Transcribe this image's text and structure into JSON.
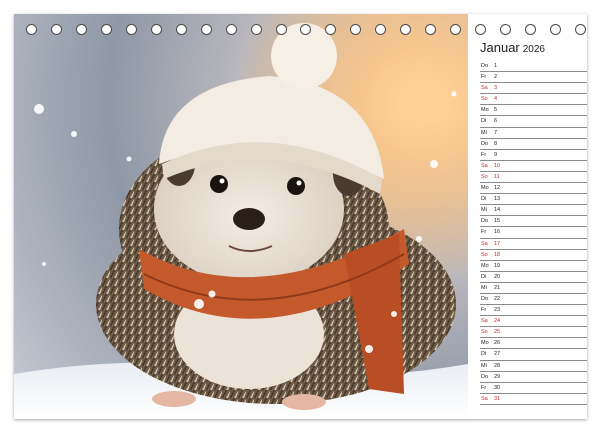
{
  "calendar": {
    "month": "Januar",
    "year": "2026",
    "days": [
      {
        "wd": "Do",
        "num": "1",
        "weekend": false
      },
      {
        "wd": "Fr",
        "num": "2",
        "weekend": false
      },
      {
        "wd": "Sa",
        "num": "3",
        "weekend": true
      },
      {
        "wd": "So",
        "num": "4",
        "weekend": true
      },
      {
        "wd": "Mo",
        "num": "5",
        "weekend": false
      },
      {
        "wd": "Di",
        "num": "6",
        "weekend": false
      },
      {
        "wd": "Mi",
        "num": "7",
        "weekend": false
      },
      {
        "wd": "Do",
        "num": "8",
        "weekend": false
      },
      {
        "wd": "Fr",
        "num": "9",
        "weekend": false
      },
      {
        "wd": "Sa",
        "num": "10",
        "weekend": true
      },
      {
        "wd": "So",
        "num": "11",
        "weekend": true
      },
      {
        "wd": "Mo",
        "num": "12",
        "weekend": false
      },
      {
        "wd": "Di",
        "num": "13",
        "weekend": false
      },
      {
        "wd": "Mi",
        "num": "14",
        "weekend": false
      },
      {
        "wd": "Do",
        "num": "15",
        "weekend": false
      },
      {
        "wd": "Fr",
        "num": "16",
        "weekend": false
      },
      {
        "wd": "Sa",
        "num": "17",
        "weekend": true
      },
      {
        "wd": "So",
        "num": "18",
        "weekend": true
      },
      {
        "wd": "Mo",
        "num": "19",
        "weekend": false
      },
      {
        "wd": "Di",
        "num": "20",
        "weekend": false
      },
      {
        "wd": "Mi",
        "num": "21",
        "weekend": false
      },
      {
        "wd": "Do",
        "num": "22",
        "weekend": false
      },
      {
        "wd": "Fr",
        "num": "23",
        "weekend": false
      },
      {
        "wd": "Sa",
        "num": "24",
        "weekend": true
      },
      {
        "wd": "So",
        "num": "25",
        "weekend": true
      },
      {
        "wd": "Mo",
        "num": "26",
        "weekend": false
      },
      {
        "wd": "Di",
        "num": "27",
        "weekend": false
      },
      {
        "wd": "Mi",
        "num": "28",
        "weekend": false
      },
      {
        "wd": "Do",
        "num": "29",
        "weekend": false
      },
      {
        "wd": "Fr",
        "num": "30",
        "weekend": false
      },
      {
        "wd": "Sa",
        "num": "31",
        "weekend": true
      }
    ]
  },
  "colors": {
    "weekend": "#c62828",
    "weekday": "#222222",
    "line": "#8a8a8a"
  },
  "photo": {
    "subject_icon": "hedgehog-illustration"
  },
  "binding": {
    "ring_count": 23,
    "ring_icon": "spiral-ring-icon"
  }
}
